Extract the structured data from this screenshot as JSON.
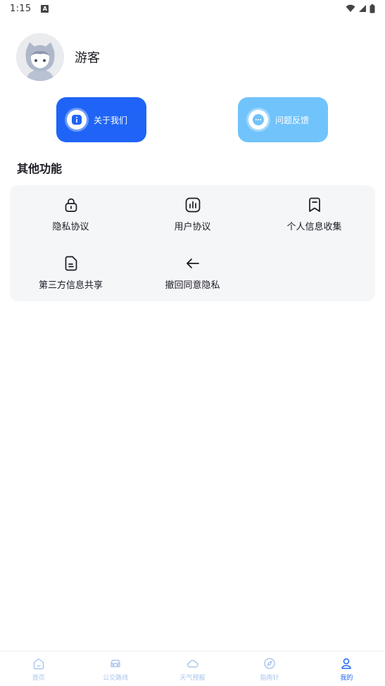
{
  "status_bar": {
    "time": "1:15",
    "notification_letter": "A"
  },
  "profile": {
    "username": "游客"
  },
  "actions": {
    "about_label": "关于我们",
    "feedback_label": "问题反馈"
  },
  "section": {
    "title": "其他功能"
  },
  "functions": [
    {
      "label": "隐私协议",
      "icon": "lock-icon"
    },
    {
      "label": "用户协议",
      "icon": "chart-icon"
    },
    {
      "label": "个人信息收集",
      "icon": "bookmark-icon"
    },
    {
      "label": "第三方信息共享",
      "icon": "document-icon"
    },
    {
      "label": "撤回同意隐私",
      "icon": "arrow-left-icon"
    }
  ],
  "bottom_nav": [
    {
      "label": "首页",
      "icon": "home-icon"
    },
    {
      "label": "公交路线",
      "icon": "bus-icon"
    },
    {
      "label": "天气预报",
      "icon": "cloud-icon"
    },
    {
      "label": "指南针",
      "icon": "compass-icon"
    },
    {
      "label": "我的",
      "icon": "user-icon",
      "active": true
    }
  ],
  "colors": {
    "primary": "#1f64f6",
    "light_blue": "#71c3fb",
    "nav_inactive": "#a8c4ee",
    "card_bg": "#f5f6f8"
  }
}
